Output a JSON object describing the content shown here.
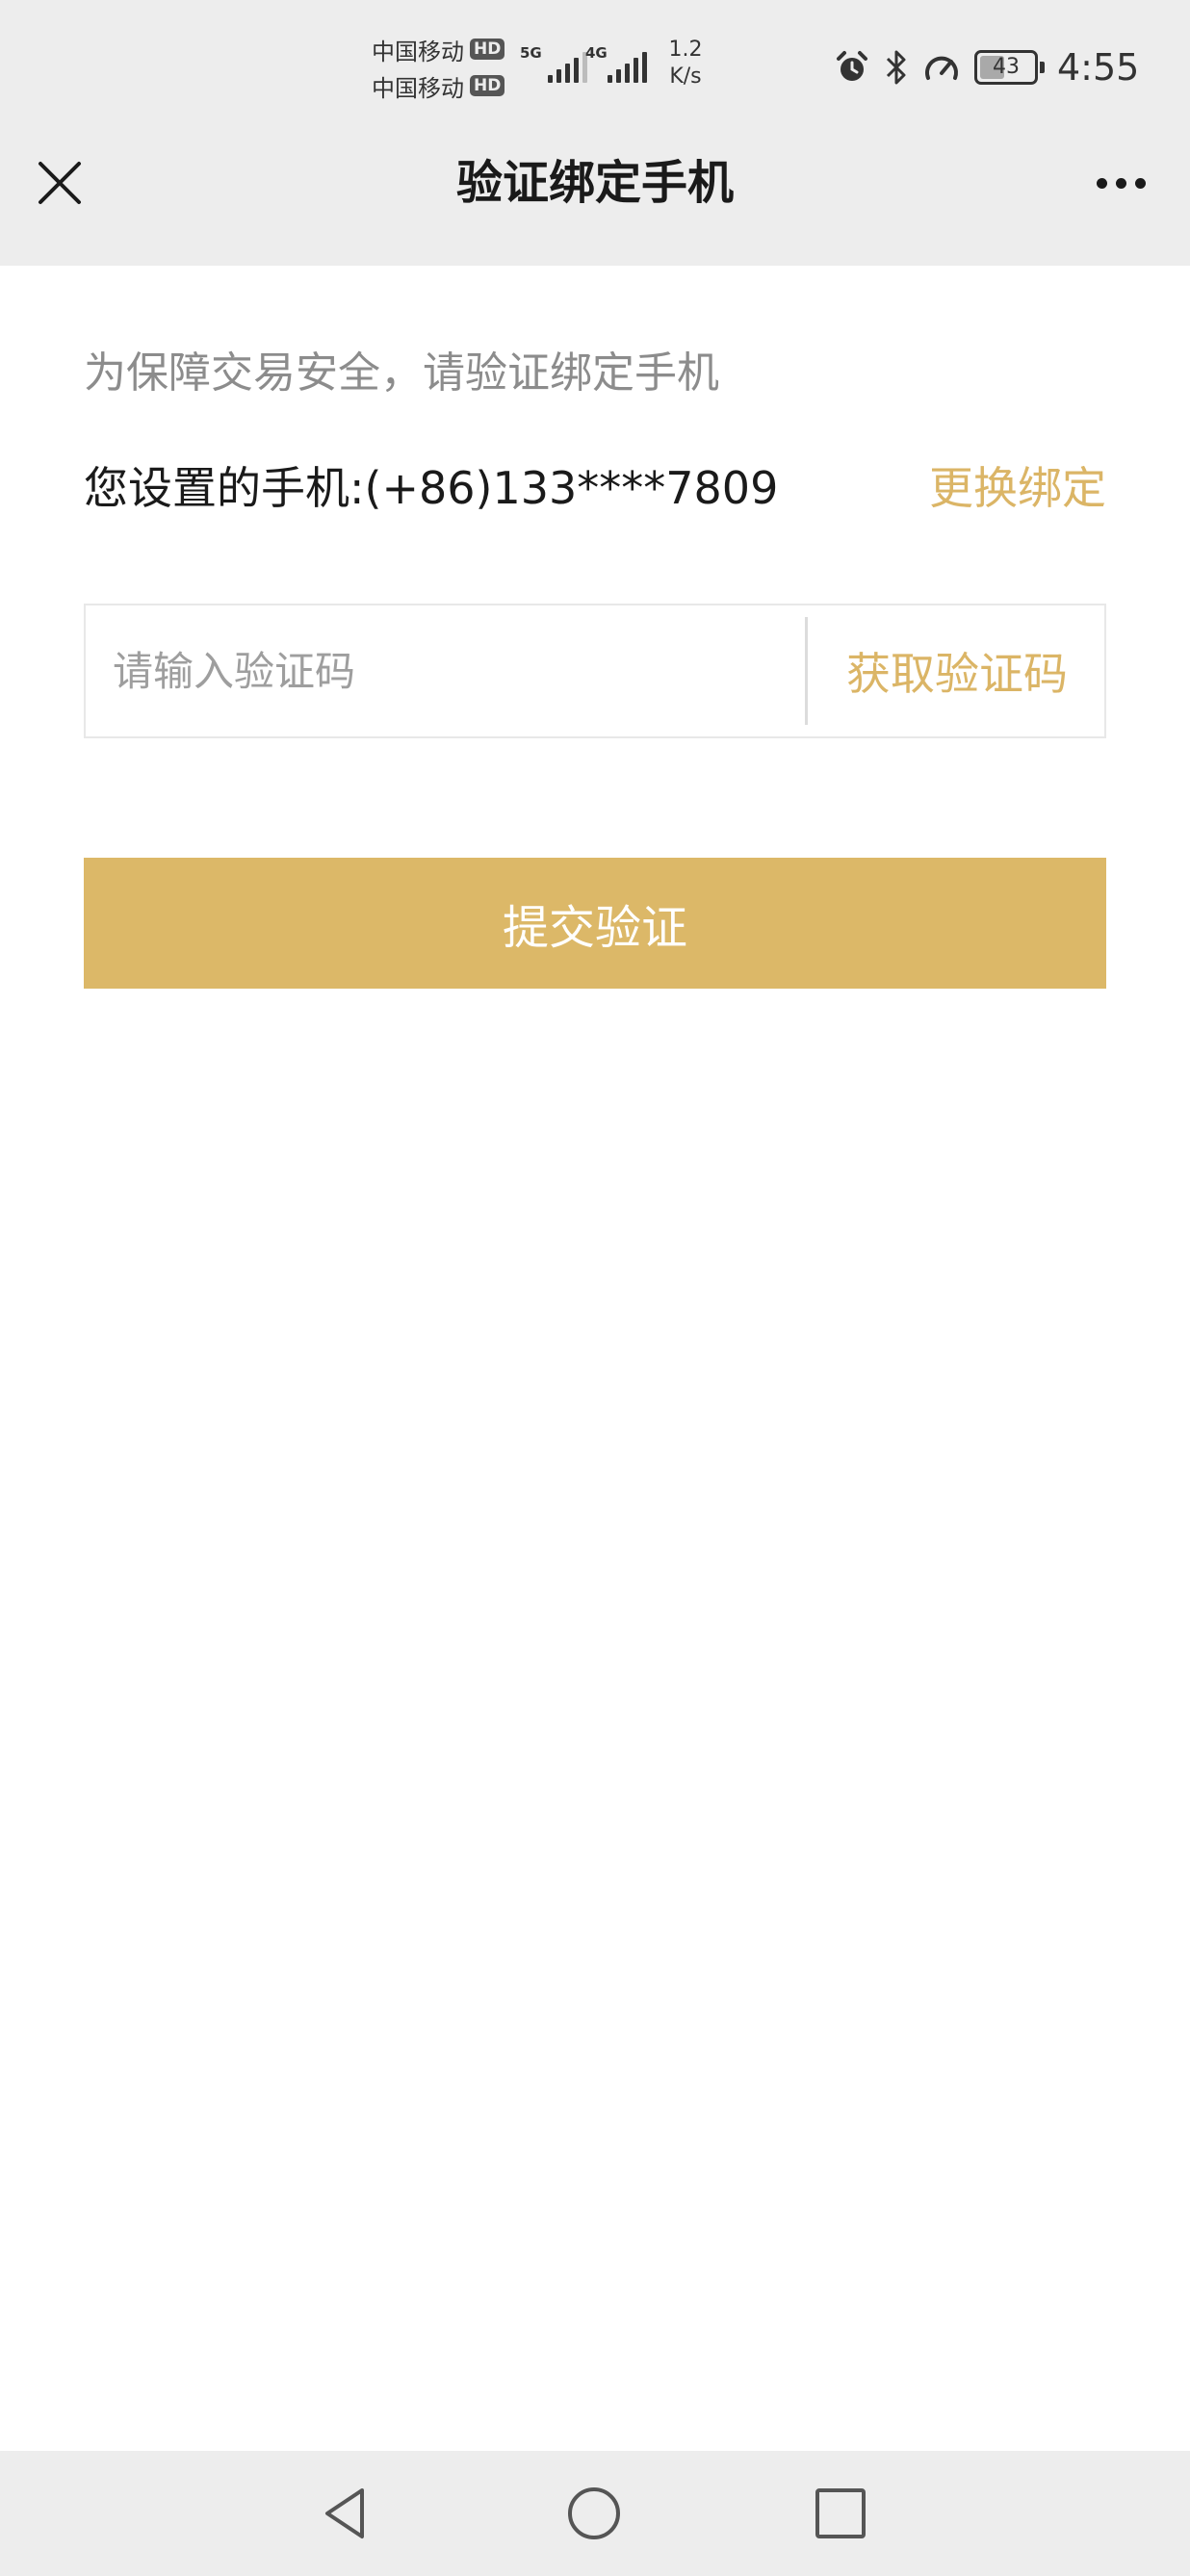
{
  "status_bar": {
    "carrier_1": "中国移动",
    "carrier_2": "中国移动",
    "hd_badge": "HD",
    "network_1": "5G",
    "network_2": "4G",
    "speed_value": "1.2",
    "speed_unit": "K/s",
    "battery_level": "43",
    "time": "4:55",
    "icons": [
      "alarm-icon",
      "bluetooth-icon",
      "speedometer-icon",
      "battery-icon"
    ]
  },
  "header": {
    "title": "验证绑定手机",
    "close_icon": "close-icon",
    "more_icon": "more-icon"
  },
  "content": {
    "notice": "为保障交易安全，请验证绑定手机",
    "phone_label": "您设置的手机:(+86)133****7809",
    "change_binding": "更换绑定",
    "code_input": {
      "value": "",
      "placeholder": "请输入验证码"
    },
    "get_code": "获取验证码",
    "submit": "提交验证"
  },
  "nav_bar": {
    "icons": [
      "back-icon",
      "home-icon",
      "recents-icon"
    ]
  },
  "colors": {
    "accent": "#dbb566",
    "button": "#dcb868",
    "bar_background": "#ededed",
    "muted_text": "#8c8c8c"
  }
}
